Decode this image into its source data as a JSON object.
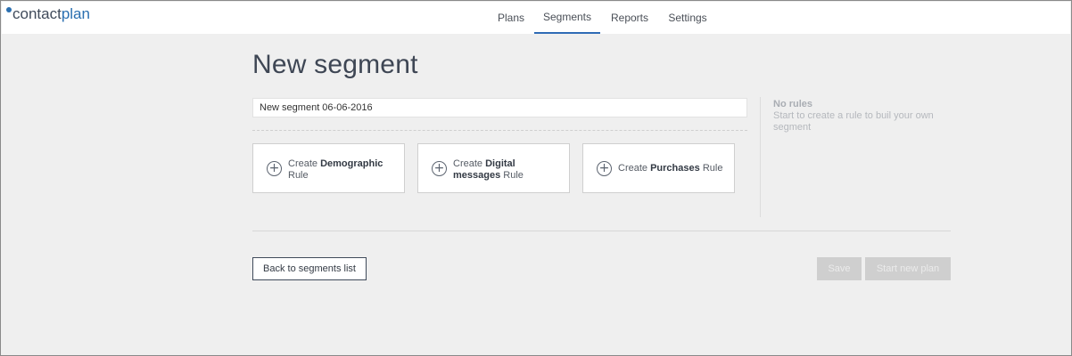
{
  "app": {
    "logo_part1": "contact",
    "logo_part2": "plan"
  },
  "nav": {
    "items": [
      {
        "label": "Plans"
      },
      {
        "label": "Segments",
        "active": true
      },
      {
        "label": "Reports"
      },
      {
        "label": "Settings"
      }
    ]
  },
  "page": {
    "title": "New segment",
    "name_value": "New segment 06-06-2016"
  },
  "rule_cards": [
    {
      "prefix": "Create",
      "bold": "Demographic",
      "suffix": "Rule",
      "icon": "plus-circle-icon"
    },
    {
      "prefix": "Create",
      "bold": "Digital messages",
      "suffix": "Rule",
      "icon": "plus-circle-icon"
    },
    {
      "prefix": "Create",
      "bold": "Purchases",
      "suffix": "Rule",
      "icon": "plus-circle-icon"
    }
  ],
  "sidebar": {
    "title": "No rules",
    "description": "Start to create a rule to buil your own segment"
  },
  "actions": {
    "back_label": "Back to segments list",
    "save_label": "Save",
    "start_label": "Start new plan"
  },
  "colors": {
    "accent": "#2f6bb5",
    "logo_blue": "#2a6fb0",
    "background": "#efefef",
    "disabled_button": "#cfcfcf"
  }
}
